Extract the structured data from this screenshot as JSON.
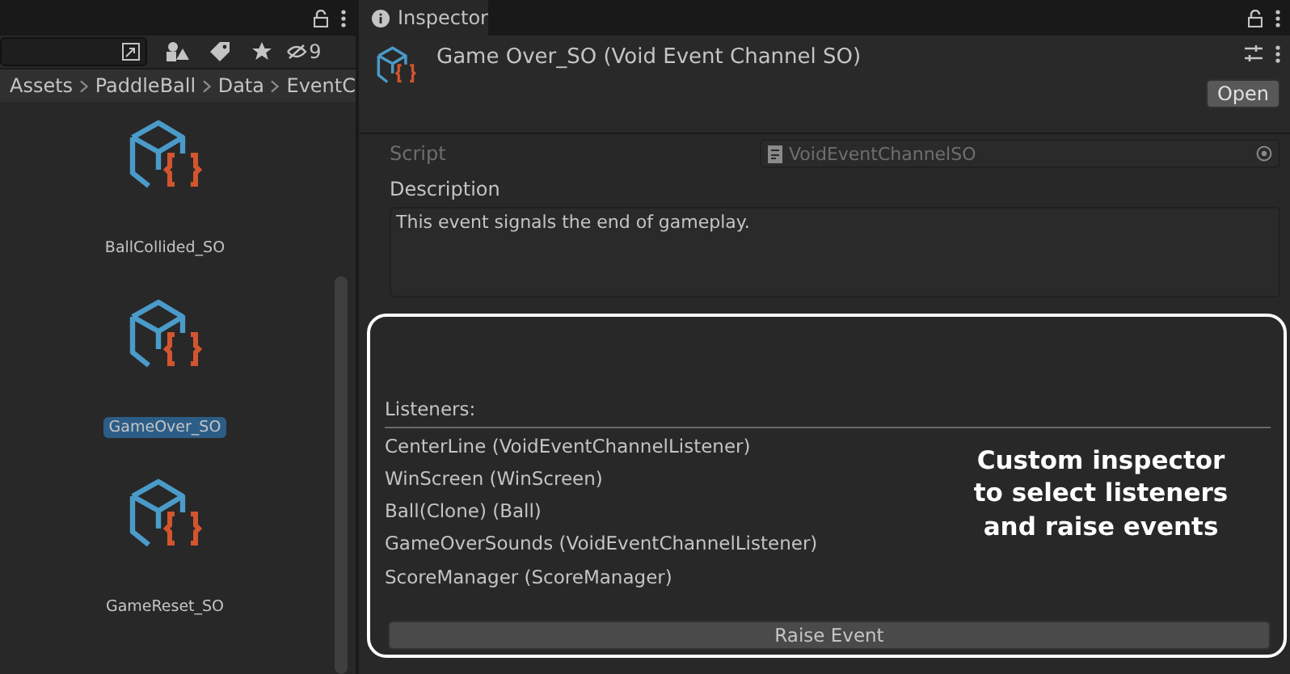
{
  "project": {
    "hidden_count": "9",
    "breadcrumb": [
      "Assets",
      "PaddleBall",
      "Data",
      "EventC"
    ],
    "assets": [
      {
        "name": "BallCollided_SO",
        "selected": false
      },
      {
        "name": "GameOver_SO",
        "selected": true
      },
      {
        "name": "GameReset_SO",
        "selected": false
      }
    ]
  },
  "inspector": {
    "tab": "Inspector",
    "title": "Game Over_SO (Void Event Channel SO)",
    "open_button": "Open",
    "script_label": "Script",
    "script_value": "VoidEventChannelSO",
    "description_label": "Description",
    "description_value": "This event signals the end of gameplay.",
    "listeners_label": "Listeners:",
    "listeners": [
      "CenterLine (VoidEventChannelListener)",
      "WinScreen (WinScreen)",
      "Ball(Clone) (Ball)",
      "GameOverSounds (VoidEventChannelListener)",
      "ScoreManager (ScoreManager)"
    ],
    "raise_button": "Raise Event",
    "callout": [
      "Custom inspector",
      "to select listeners",
      "and raise events"
    ]
  }
}
